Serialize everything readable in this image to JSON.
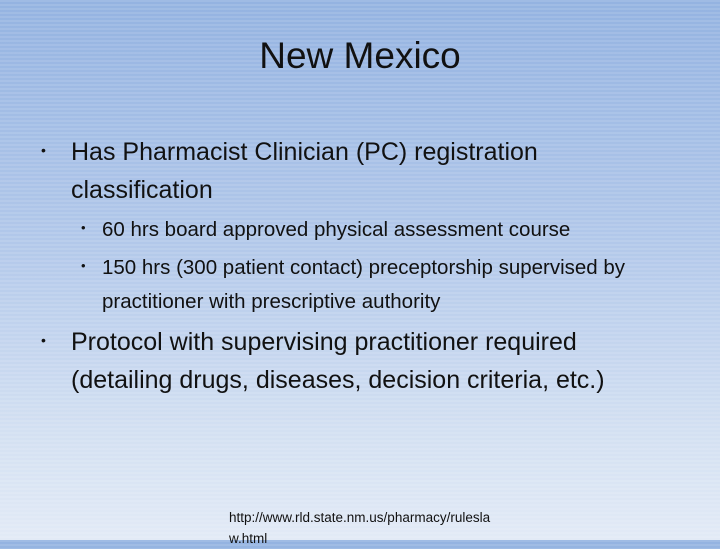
{
  "slide": {
    "title": "New Mexico",
    "bullets": [
      {
        "marker": "•",
        "text": "Has Pharmacist Clinician (PC) registration classification",
        "sub": [
          {
            "marker": "•",
            "text": "60 hrs board approved physical assessment course"
          },
          {
            "marker": "•",
            "text": "150 hrs (300 patient contact) preceptorship supervised by practitioner with prescriptive authority"
          }
        ]
      },
      {
        "marker": "•",
        "text": "Protocol with supervising practitioner required (detailing drugs, diseases, decision criteria, etc.)"
      }
    ],
    "source": "http://www.rld.state.nm.us/pharmacy/ruleslaw.html"
  }
}
